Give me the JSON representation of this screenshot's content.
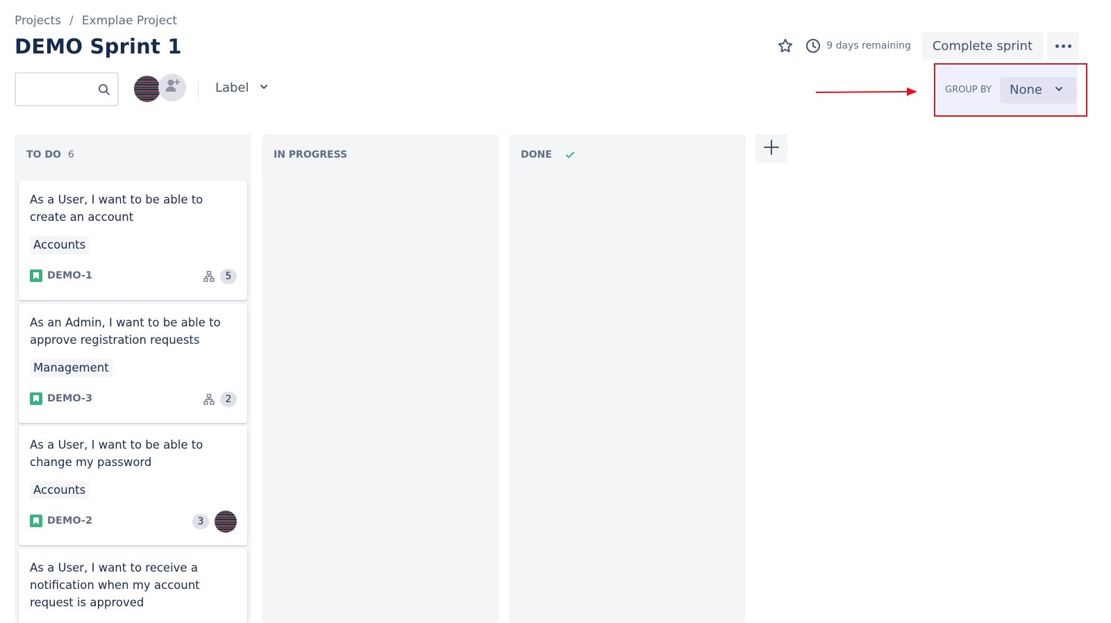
{
  "breadcrumb": {
    "root": "Projects",
    "separator": "/",
    "project": "Exmplae Project"
  },
  "page": {
    "title": "DEMO Sprint 1"
  },
  "header": {
    "star_icon": "star-icon",
    "clock_icon": "clock-icon",
    "remaining": "9 days remaining",
    "complete_label": "Complete sprint",
    "more_icon": "more-horizontal-icon"
  },
  "toolbar": {
    "search": {
      "value": "",
      "placeholder": ""
    },
    "filter_label": "Label"
  },
  "group_by": {
    "label": "GROUP BY",
    "value": "None"
  },
  "columns": [
    {
      "name": "TO DO",
      "count": "6"
    },
    {
      "name": "IN PROGRESS"
    },
    {
      "name": "DONE"
    }
  ],
  "cards": [
    {
      "title": "As a User, I want to be able to create an account",
      "label": "Accounts",
      "key": "DEMO-1",
      "subtasks": "5"
    },
    {
      "title": "As an Admin, I want to be able to approve registration requests",
      "label": "Management",
      "key": "DEMO-3",
      "subtasks": "2"
    },
    {
      "title": "As a User, I want to be able to change my password",
      "label": "Accounts",
      "key": "DEMO-2",
      "count": "3"
    },
    {
      "title": "As a User, I want to receive a notification when my account request is approved"
    }
  ],
  "colors": {
    "accent_red": "#e3121e",
    "story_green": "#36b37e",
    "column_bg": "#f4f5f7",
    "done_check": "#36b37e"
  }
}
